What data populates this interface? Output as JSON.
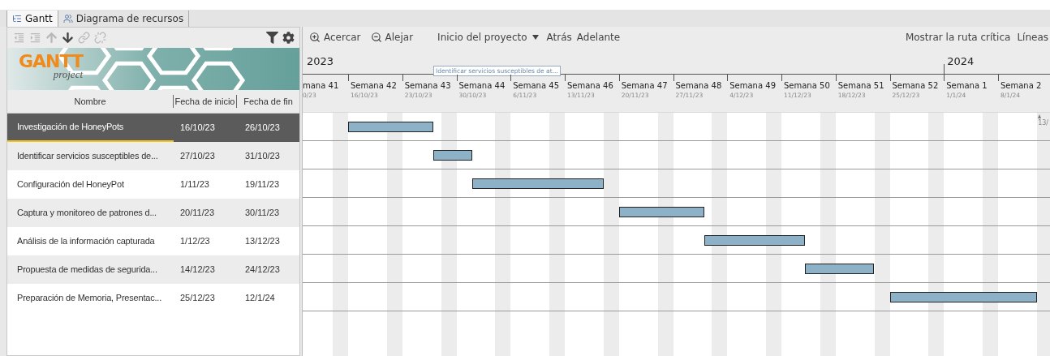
{
  "tabs": [
    {
      "kind": "gantt",
      "label": "Gantt",
      "selected": true
    },
    {
      "kind": "resources",
      "label": "Diagrama de recursos",
      "selected": false
    }
  ],
  "task_toolbar": {
    "buttons": [
      {
        "kind": "outdent",
        "disabled": true
      },
      {
        "kind": "indent",
        "disabled": true
      },
      {
        "kind": "move-up",
        "disabled": true
      },
      {
        "kind": "move-down",
        "disabled": false
      },
      {
        "kind": "link",
        "disabled": true
      },
      {
        "kind": "unlink",
        "disabled": true
      },
      {
        "kind": "filter",
        "disabled": false
      },
      {
        "kind": "settings",
        "disabled": false
      }
    ]
  },
  "logo": {
    "title": "GANTT",
    "subtitle": "project"
  },
  "table": {
    "columns": [
      "Nombre",
      "Fecha de inicio",
      "Fecha de fin"
    ],
    "rows": [
      {
        "name": "Investigación de HoneyPots",
        "start": "16/10/23",
        "end": "26/10/23",
        "selected": true
      },
      {
        "name": "Identificar servicios susceptibles de...",
        "start": "27/10/23",
        "end": "31/10/23",
        "selected": false
      },
      {
        "name": "Configuración del HoneyPot",
        "start": "1/11/23",
        "end": "19/11/23",
        "selected": false
      },
      {
        "name": "Captura y monitoreo de patrones d...",
        "start": "20/11/23",
        "end": "30/11/23",
        "selected": false
      },
      {
        "name": "Análisis de la información capturada",
        "start": "1/12/23",
        "end": "13/12/23",
        "selected": false
      },
      {
        "name": "Propuesta de medidas de segurida...",
        "start": "14/12/23",
        "end": "24/12/23",
        "selected": false
      },
      {
        "name": "Preparación de Memoria, Presentac...",
        "start": "25/12/23",
        "end": "12/1/24",
        "selected": false
      }
    ]
  },
  "chart_toolbar": {
    "zoom_in": "Acercar",
    "zoom_out": "Alejar",
    "navigation": "Inicio del proyecto",
    "back": "Atrás",
    "forward": "Adelante",
    "critical_path": "Mostrar la ruta crítica",
    "lines": "Líneas"
  },
  "timeline": {
    "tooltip": "Identificar servicios susceptibles de at...",
    "marker": "13/",
    "years": [
      {
        "label": "2023",
        "weeks": [
          {
            "label": "mana 41",
            "date": "0/23"
          },
          {
            "label": "Semana 42",
            "date": "16/10/23"
          },
          {
            "label": "Semana 43",
            "date": "23/10/23"
          },
          {
            "label": "Semana 44",
            "date": "30/10/23"
          },
          {
            "label": "Semana 45",
            "date": "6/11/23"
          },
          {
            "label": "Semana 46",
            "date": "13/11/23"
          },
          {
            "label": "Semana 47",
            "date": "20/11/23"
          },
          {
            "label": "Semana 48",
            "date": "27/11/23"
          },
          {
            "label": "Semana 49",
            "date": "4/12/23"
          },
          {
            "label": "Semana 50",
            "date": "11/12/23"
          },
          {
            "label": "Semana 51",
            "date": "18/12/23"
          },
          {
            "label": "Semana 52",
            "date": "25/12/23"
          }
        ]
      },
      {
        "label": "2024",
        "weeks": [
          {
            "label": "Semana 1",
            "date": "1/1/24"
          },
          {
            "label": "Semana 2",
            "date": "8/1/24"
          }
        ]
      }
    ]
  }
}
